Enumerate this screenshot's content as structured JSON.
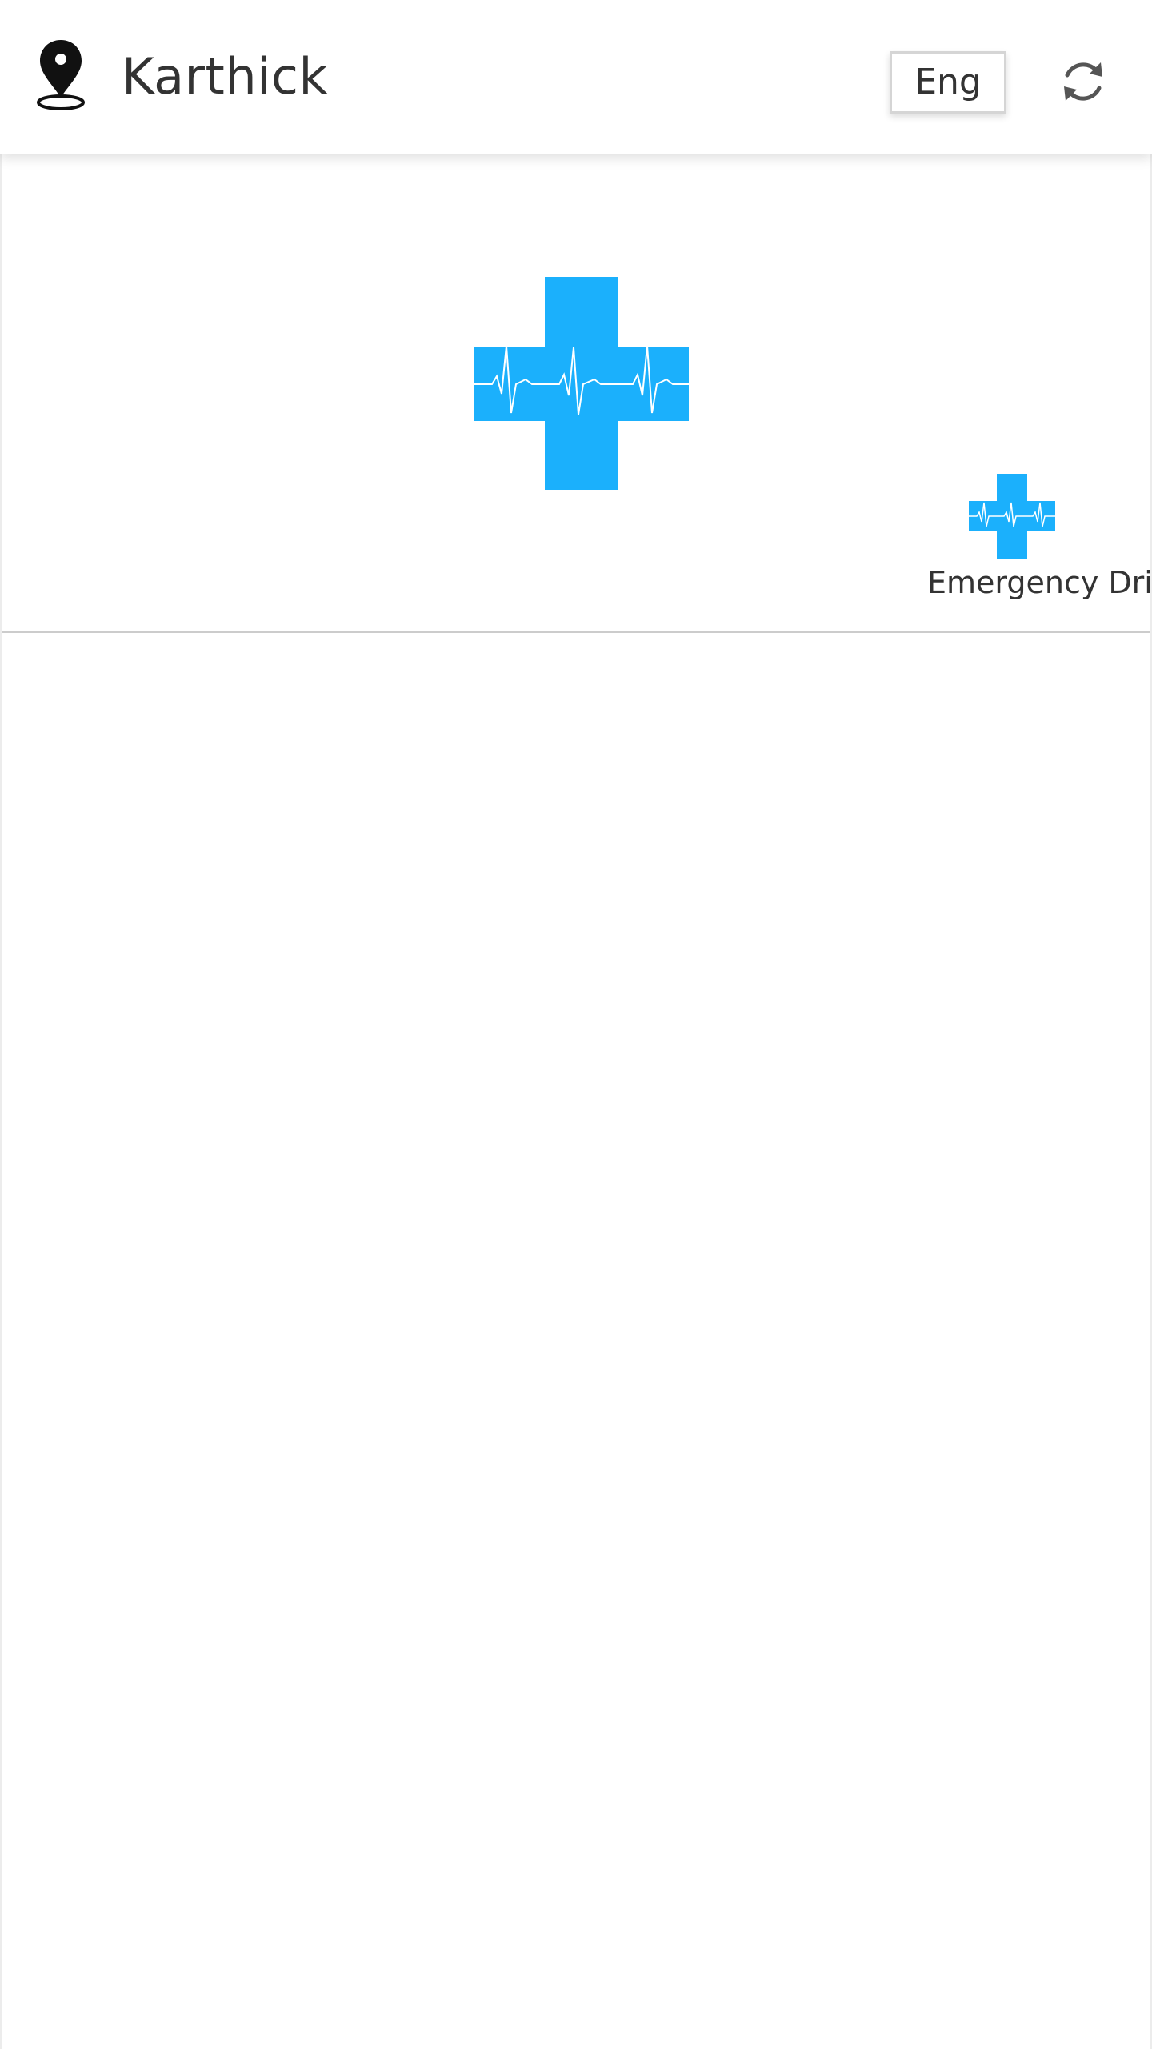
{
  "header": {
    "user_name": "Karthick",
    "language_label": "Eng",
    "location_icon": "location-pin-icon",
    "refresh_icon": "refresh-icon"
  },
  "banner": {
    "logo_icon": "medical-cross-heartbeat-icon"
  },
  "quick_actions": [
    {
      "label": "Emergency Dril",
      "icon": "medical-cross-heartbeat-icon"
    }
  ],
  "colors": {
    "accent": "#1BB0FC",
    "header_bg": "#FFFFFF",
    "text": "#333333",
    "divider": "#CCCCCC"
  }
}
